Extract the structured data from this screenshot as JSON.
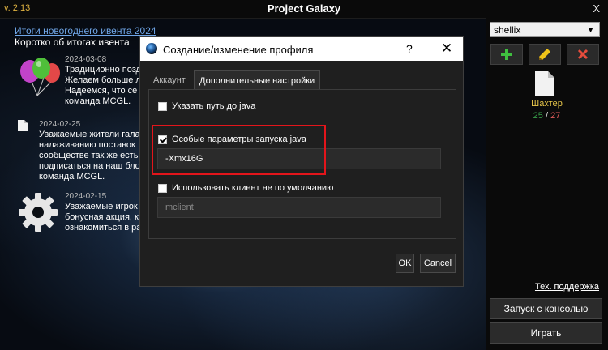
{
  "titlebar": {
    "version": "v. 2.13",
    "title": "Project Galaxy",
    "close": "X"
  },
  "news": {
    "link": "Итоги новогоднего ивента 2024",
    "subtitle": "Коротко об итогах ивента",
    "items": [
      {
        "date": "2024-03-08",
        "icon": "balloons-icon",
        "lines": [
          "Традиционно позд",
          "Желаем больше л",
          "Надеемся, что се",
          "команда MCGL."
        ]
      },
      {
        "date": "2024-02-25",
        "icon": "document-icon",
        "lines": [
          "Уважаемые жители гала",
          "налаживанию поставок",
          "сообществе так же есть",
          "подписаться на наш бло",
          "команда MCGL."
        ]
      },
      {
        "date": "2024-02-15",
        "icon": "gear-icon",
        "lines": [
          "Уважаемые игрок",
          "бонусная акция, к",
          "ознакомиться в ра"
        ]
      }
    ]
  },
  "panel": {
    "user": "shellix",
    "profile_name": "Шахтер",
    "count_current": "25",
    "count_separator": "/",
    "count_total": "27",
    "support_link": "Тех. поддержка",
    "console_button": "Запуск с консолью",
    "play_button": "Играть"
  },
  "dialog": {
    "title": "Создание/изменение профиля",
    "help": "?",
    "close": "✕",
    "tabs": [
      "Аккаунт",
      "Дополнительные настройки"
    ],
    "java_path_label": "Указать путь до java",
    "java_params_label": "Особые параметры запуска java",
    "java_params_value": "-Xmx16G",
    "custom_client_label": "Использовать клиент не по умолчанию",
    "custom_client_value": "mclient",
    "ok": "OK",
    "cancel": "Cancel"
  },
  "colors": {
    "accent_yellow": "#e7c64a",
    "link_blue": "#6fa6e8",
    "highlight_red": "#e3151b",
    "count_green": "#37a04a",
    "count_red": "#e25a5a"
  }
}
